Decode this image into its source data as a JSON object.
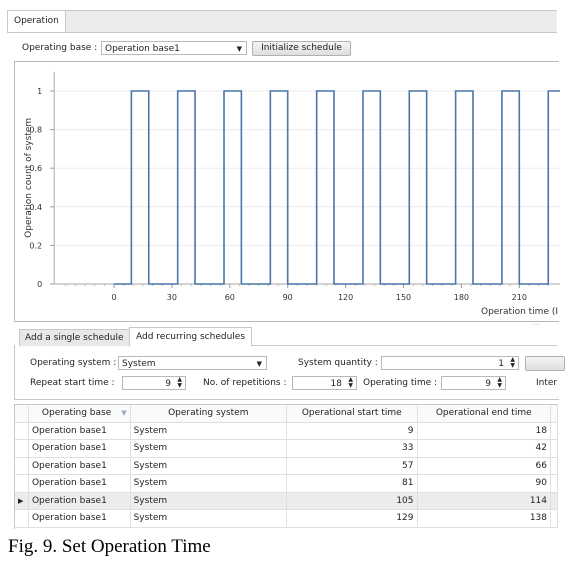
{
  "main_tab": "Operation",
  "toolbar": {
    "base_label": "Operating base :",
    "base_value": "Operation base1",
    "init_button": "Initialize schedule"
  },
  "chart_data": {
    "type": "line",
    "step": true,
    "xlabel": "Operation time (I",
    "ylabel": "Operation count of system",
    "xlim": [
      -31,
      230
    ],
    "ylim": [
      0,
      1.1
    ],
    "xticks": [
      0,
      30,
      60,
      90,
      120,
      150,
      180,
      210
    ],
    "yticks": [
      "0",
      "0.2",
      "0.4",
      "0.6",
      "0.8",
      "1"
    ],
    "grid": true,
    "color": "#4a76a8",
    "pulses": [
      [
        9,
        18
      ],
      [
        33,
        42
      ],
      [
        57,
        66
      ],
      [
        81,
        90
      ],
      [
        105,
        114
      ],
      [
        129,
        138
      ],
      [
        153,
        162
      ],
      [
        177,
        186
      ],
      [
        201,
        210
      ],
      [
        225,
        234
      ]
    ]
  },
  "subtabs": [
    "Add a single schedule",
    "Add recurring schedules"
  ],
  "form": {
    "system_label": "Operating system :",
    "system_value": "System",
    "qty_label": "System quantity :",
    "qty_value": "1",
    "repeat_label": "Repeat start time :",
    "repeat_value": "9",
    "reps_label": "No. of repetitions :",
    "reps_value": "18",
    "optime_label": "Operating time :",
    "optime_value": "9",
    "interval_label": "Inter"
  },
  "table": {
    "headers": [
      "Operating base",
      "Operating system",
      "Operational start time",
      "Operational end time"
    ],
    "rows": [
      [
        "Operation base1",
        "System",
        "9",
        "18"
      ],
      [
        "Operation base1",
        "System",
        "33",
        "42"
      ],
      [
        "Operation base1",
        "System",
        "57",
        "66"
      ],
      [
        "Operation base1",
        "System",
        "81",
        "90"
      ],
      [
        "Operation base1",
        "System",
        "105",
        "114"
      ],
      [
        "Operation base1",
        "System",
        "129",
        "138"
      ]
    ]
  },
  "caption": "Fig. 9. Set Operation Time"
}
